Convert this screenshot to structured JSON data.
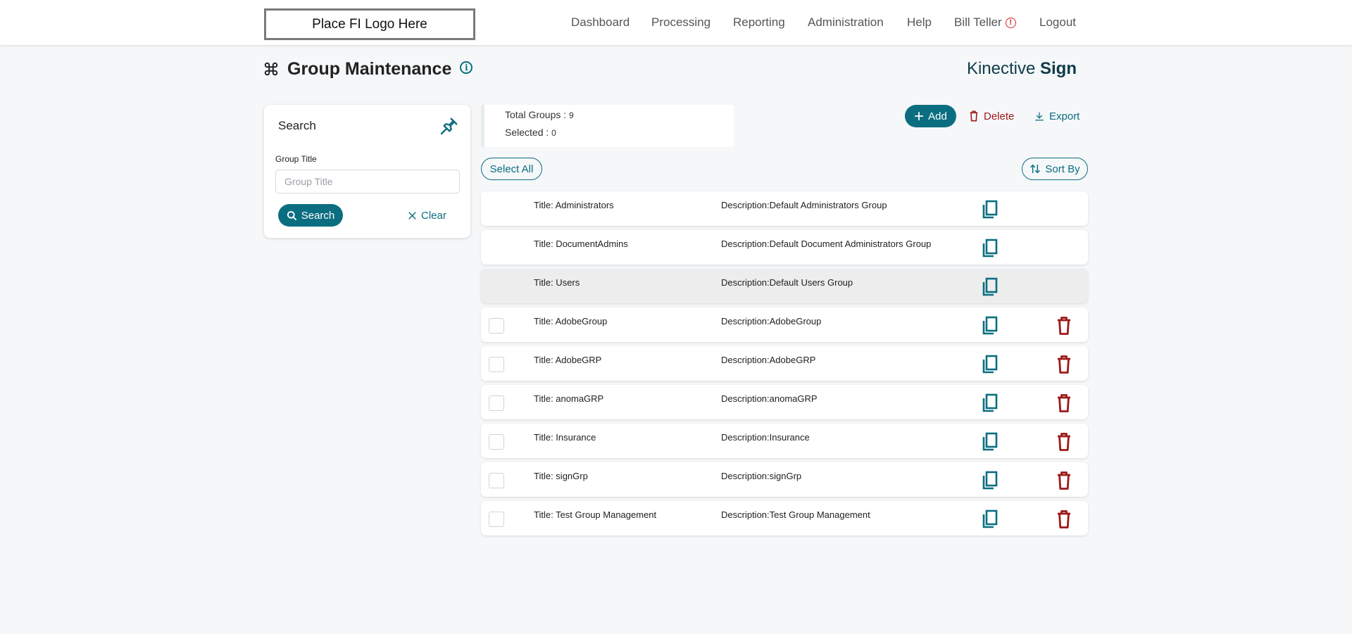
{
  "header": {
    "logo_text": "Place FI Logo Here",
    "nav": [
      "Dashboard",
      "Processing",
      "Reporting",
      "Administration",
      "Help"
    ],
    "user_name": "Bill Teller",
    "logout_label": "Logout"
  },
  "page": {
    "title": "Group Maintenance",
    "brand_light": "Kinective ",
    "brand_bold": "Sign"
  },
  "search": {
    "header": "Search",
    "field_label": "Group Title",
    "field_placeholder": "Group Title",
    "field_value": "",
    "search_label": "Search",
    "clear_label": "Clear"
  },
  "summary": {
    "total_label": "Total Groups : ",
    "total_value": "9",
    "selected_label": "Selected : ",
    "selected_value": "0"
  },
  "toolbar": {
    "add_label": "Add",
    "delete_label": "Delete",
    "export_label": "Export",
    "select_all_label": "Select All",
    "sort_label": "Sort By"
  },
  "colors": {
    "accent": "#0b6e80",
    "danger": "#9c1a1a",
    "alert": "#d62020"
  },
  "groups": [
    {
      "title": "Title: Administrators",
      "description": "Description:Default Administrators Group",
      "selectable": false,
      "deletable": false
    },
    {
      "title": "Title: DocumentAdmins",
      "description": "Description:Default Document Administrators Group",
      "selectable": false,
      "deletable": false
    },
    {
      "title": "Title: Users",
      "description": "Description:Default Users Group",
      "selectable": false,
      "deletable": false
    },
    {
      "title": "Title: AdobeGroup",
      "description": "Description:AdobeGroup",
      "selectable": true,
      "deletable": true
    },
    {
      "title": "Title: AdobeGRP",
      "description": "Description:AdobeGRP",
      "selectable": true,
      "deletable": true
    },
    {
      "title": "Title: anomaGRP",
      "description": "Description:anomaGRP",
      "selectable": true,
      "deletable": true
    },
    {
      "title": "Title: Insurance",
      "description": "Description:Insurance",
      "selectable": true,
      "deletable": true
    },
    {
      "title": "Title: signGrp",
      "description": "Description:signGrp",
      "selectable": true,
      "deletable": true
    },
    {
      "title": "Title: Test Group Management",
      "description": "Description:Test Group Management",
      "selectable": true,
      "deletable": true
    }
  ]
}
